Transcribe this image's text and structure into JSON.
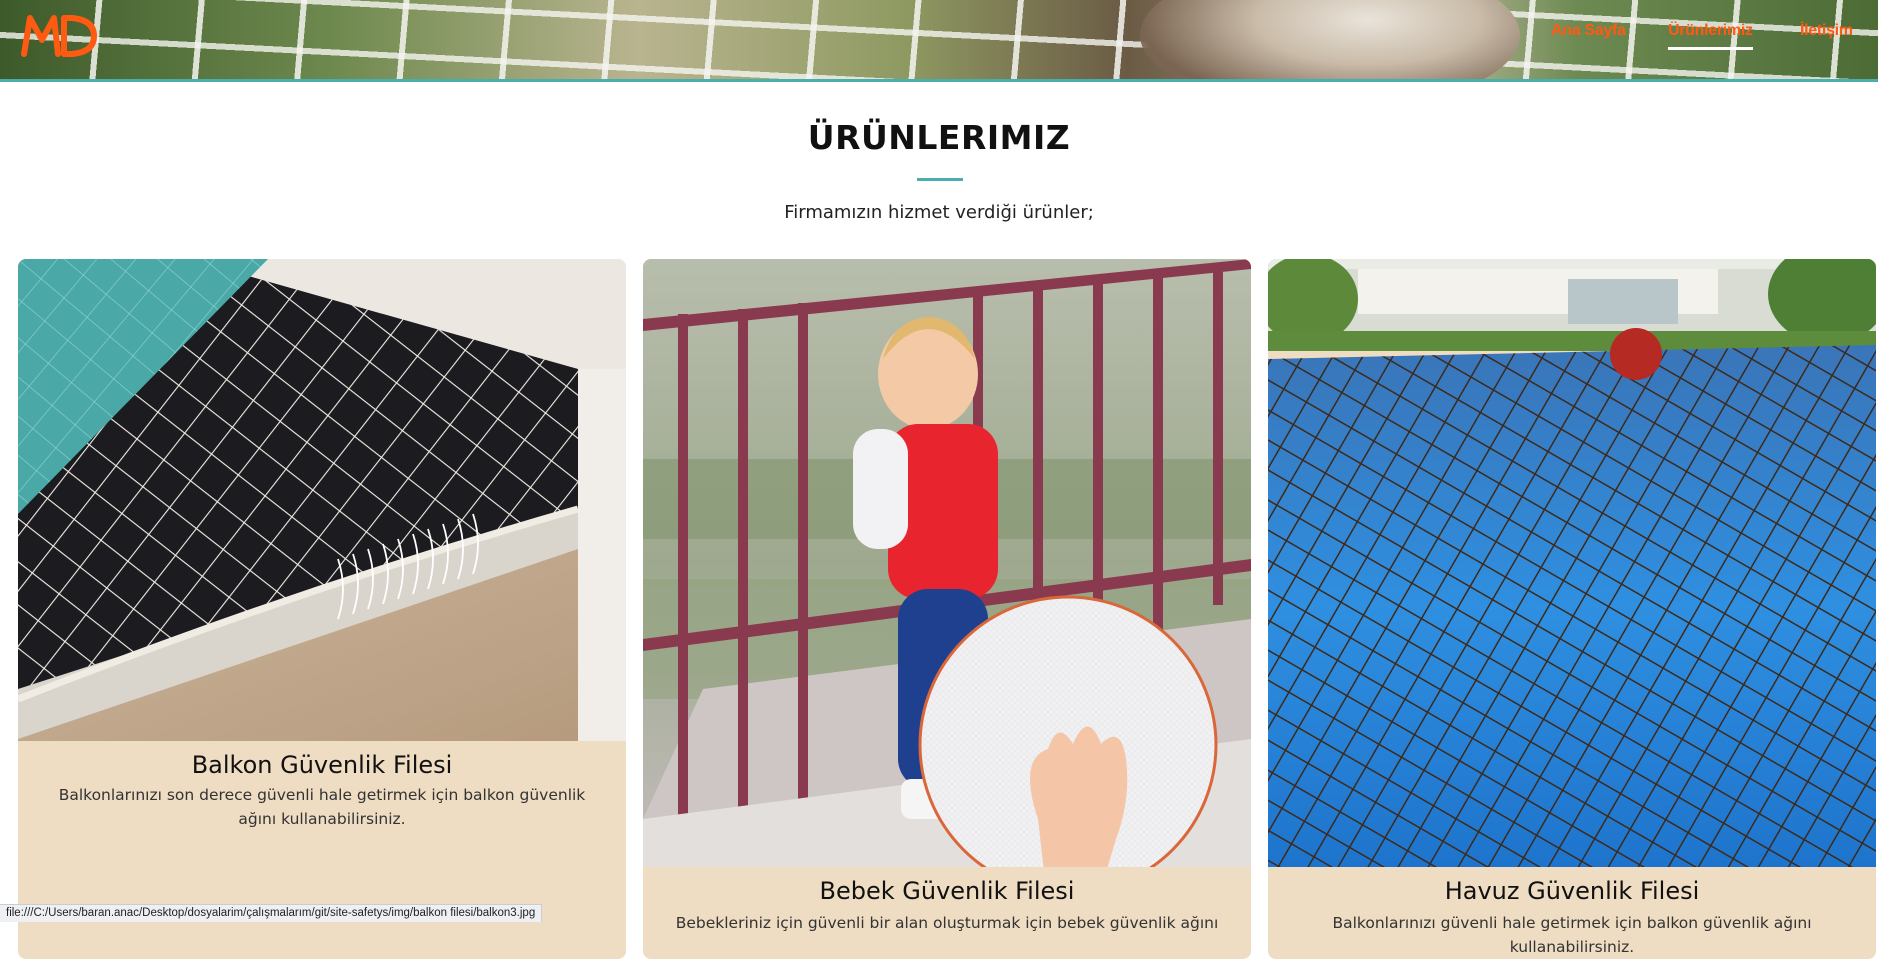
{
  "header": {
    "logo_text": "MD",
    "nav": [
      {
        "label": "Ana Sayfa",
        "active": false
      },
      {
        "label": "Ürünlerimiz",
        "active": true
      },
      {
        "label": "İletişim",
        "active": false
      }
    ],
    "accent_color": "#ff5a12",
    "teal_color": "#4aaeb0"
  },
  "section": {
    "title": "ÜRÜNLERIMIZ",
    "subtitle": "Firmamızın hizmet verdiği ürünler;"
  },
  "products": [
    {
      "title": "Balkon Güvenlik Filesi",
      "description": "Balkonlarınızı son derece güvenli hale getirmek için balkon güvenlik ağını kullanabilirsiniz.",
      "image": "balcony-net-photo"
    },
    {
      "title": "Bebek Güvenlik Filesi",
      "description": "Bebekleriniz için güvenli bir alan oluşturmak için bebek güvenlik ağını",
      "image": "baby-net-photo"
    },
    {
      "title": "Havuz Güvenlik Filesi",
      "description": "Balkonlarınızı güvenli hale getirmek için balkon güvenlik ağını kullanabilirsiniz.",
      "image": "pool-net-photo"
    }
  ],
  "status_bar": {
    "url": "file:///C:/Users/baran.anac/Desktop/dosyalarim/çalışmalarım/git/site-safetys/img/balkon filesi/balkon3.jpg"
  }
}
